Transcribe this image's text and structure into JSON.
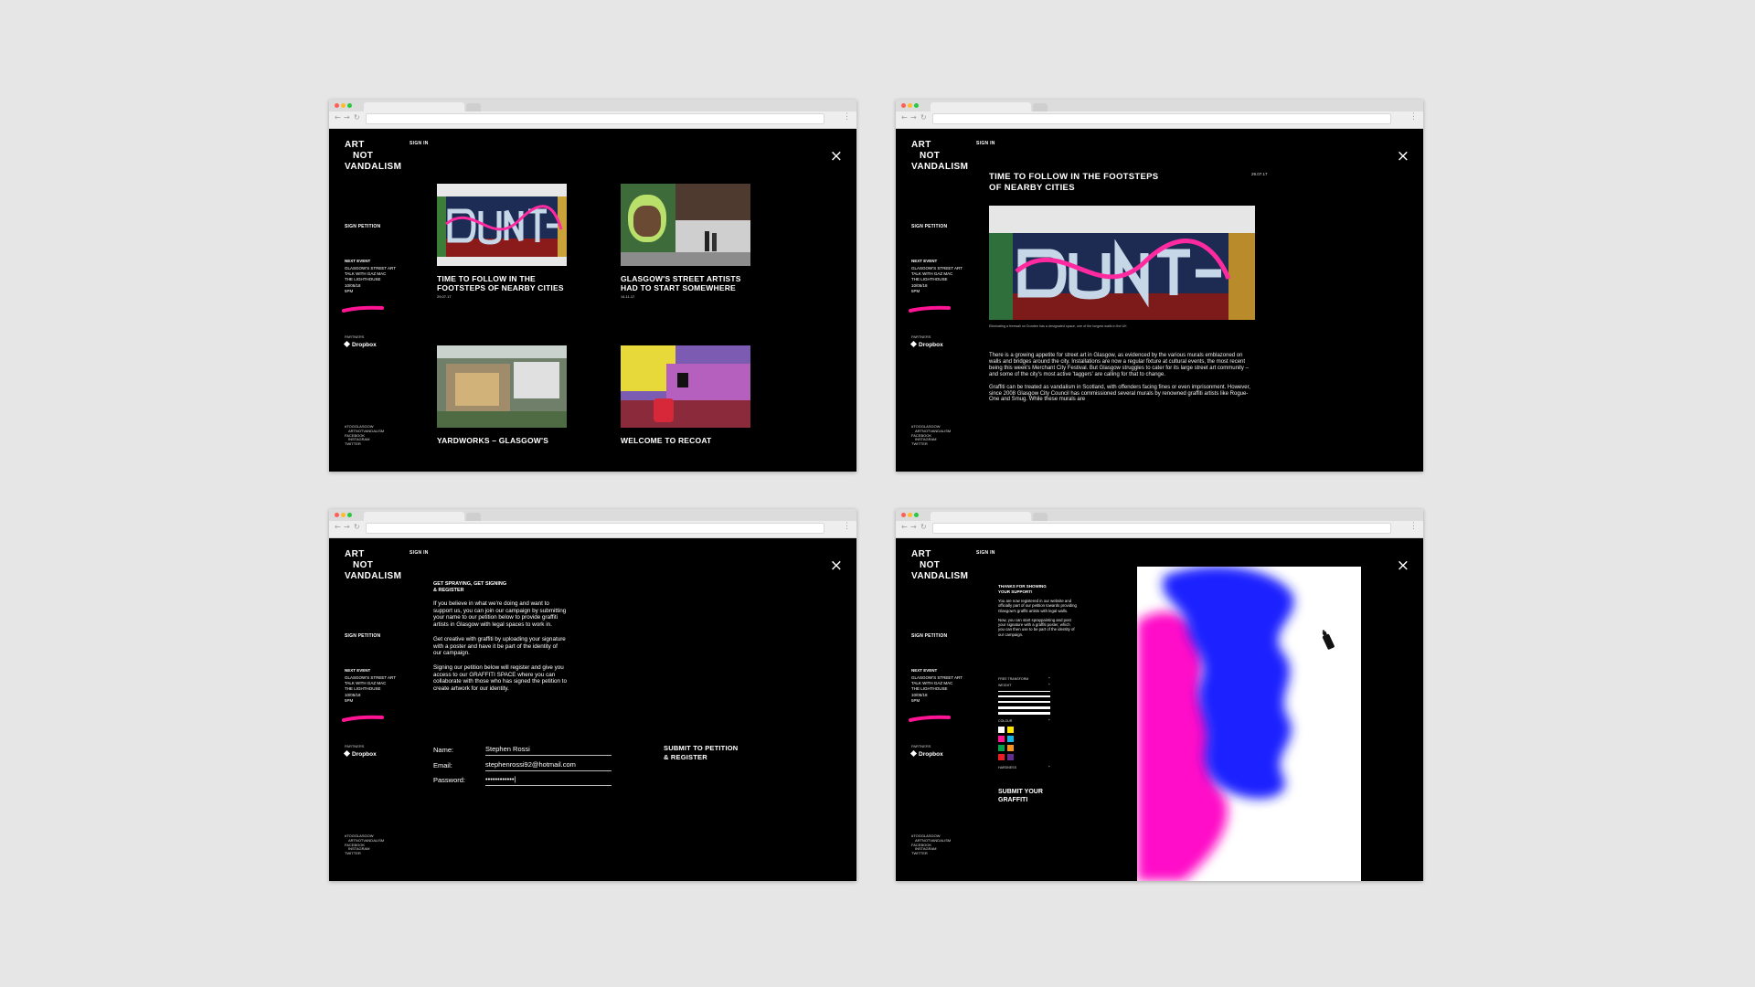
{
  "browser": {
    "back": "←",
    "forward": "→",
    "reload": "↻",
    "menu": "⋮"
  },
  "site": {
    "logo": [
      "ART",
      "NOT",
      "VANDALISM"
    ],
    "sign_in": "SIGN IN",
    "sign_petition": "SIGN PETITION",
    "next_event_title": "NEXT EVENT",
    "next_event_lines": [
      "GLASGOW'S STREET ART",
      "TALK WITH GAZ MAC",
      "THE LIGHTHOUSE",
      "10/05/18",
      "5PM"
    ],
    "partners_label": "PARTNERS",
    "partner_name": "Dropbox",
    "social": [
      "#TOGGLASGOW",
      "ARTNOTVANDALISM",
      "FACEBOOK",
      "INSTAGRAM",
      "TWITTER"
    ],
    "close": "×"
  },
  "colors": {
    "accent_pink": "#ff1493",
    "paint_blue": "#1e22ff",
    "background": "#000000"
  },
  "screens": {
    "list": {
      "cards": [
        {
          "title": "TIME TO FOLLOW IN THE FOOTSTEPS OF NEARBY CITIES",
          "date": "29.07.17"
        },
        {
          "title": "GLASGOW'S STREET ARTISTS HAD TO START SOMEWHERE",
          "date": "14.11.17"
        },
        {
          "title": "YARDWORKS – GLASGOW'S",
          "date": ""
        },
        {
          "title": "WELCOME TO RECOAT",
          "date": ""
        }
      ]
    },
    "article": {
      "title_lines": [
        "TIME TO FOLLOW IN THE FOOTSTEPS",
        "OF NEARBY CITIES"
      ],
      "date": "29.07.17",
      "caption": "Eliminating a freewall on Dundee has a designated space, one of the longest walls in the UK",
      "paragraphs": [
        "There is a growing appetite for street art in Glasgow, as evidenced by the various murals emblazoned on walls and bridges around the city. Installations are now a regular fixture at cultural events, the most recent being this week's Merchant City Festival. But Glasgow struggles to cater for its large street art community – and some of the city's most active 'taggers' are calling for that to change.",
        "Graffiti can be treated as vandalism in Scotland, with offenders facing fines or even imprisonment. However, since 2008 Glasgow City Council has commissioned several murals by renowned graffiti artists like Rogue-One and Smug. While these murals are"
      ]
    },
    "register": {
      "title_lines": [
        "GET SPRAYING, GET SIGNING",
        "& REGISTER"
      ],
      "paragraphs": [
        "If you believe in what we're doing and want to support us, you can join our campaign by submitting your name to our petition below to provide graffiti artists in Glasgow with legal spaces to work in.",
        "Get creative with graffiti by uploading your signature with a poster and have it be part of the identity of our campaign.",
        "Signing our petition below will register and give you access to our GRAFFITI SPACE where you can collaborate with those who has signed the petition to create artwork for our identity."
      ],
      "form": {
        "name_label": "Name:",
        "name_value": "Stephen Rossi",
        "email_label": "Email:",
        "email_value": "stephenrossi92@hotmail.com",
        "password_label": "Password:",
        "password_value": "••••••••••••|"
      },
      "submit_lines": [
        "SUBMIT TO PETITION",
        "& REGISTER"
      ]
    },
    "graffiti": {
      "title_lines": [
        "THANKS FOR SHOWING",
        "YOUR SUPPORT!"
      ],
      "paragraphs": [
        "You are now registered in our website and officially part of our petition towards providing Glasgow's graffiti artists with legal walls.",
        "Now, you can start spraypainting and post your signature with a graffiti poster, which you can then use to be part of the identity of our campaign."
      ],
      "tools": {
        "freehand_label": "FREE TRANSFORM",
        "weight_label": "WEIGHT",
        "colour_label": "COLOUR",
        "hardness_label": "HARDNESS",
        "toggle": "+"
      },
      "swatches": [
        "#ffffff",
        "#ffe600",
        "#ff1493",
        "#12b6e6",
        "#00a14b",
        "#f7941d",
        "#ed1c24",
        "#662d91"
      ],
      "submit_lines": [
        "SUBMIT YOUR",
        "GRAFFITI"
      ]
    }
  }
}
